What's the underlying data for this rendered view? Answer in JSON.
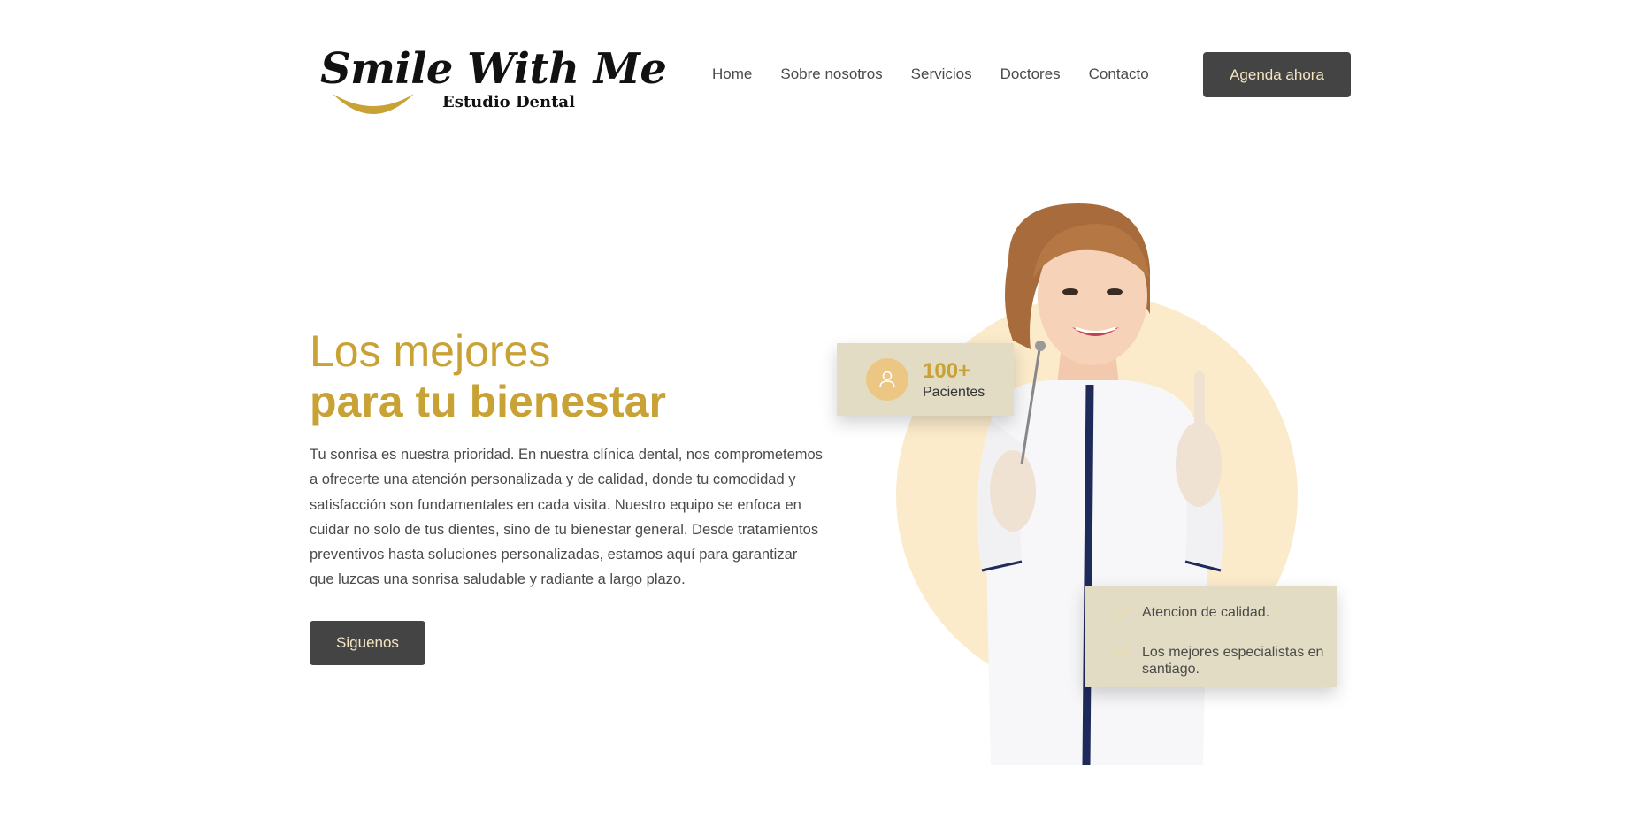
{
  "brand": {
    "title": "Smile With Me",
    "subtitle": "Estudio Dental",
    "accent": "#c9a235"
  },
  "nav": {
    "items": [
      {
        "label": "Home"
      },
      {
        "label": "Sobre nosotros"
      },
      {
        "label": "Servicios"
      },
      {
        "label": "Doctores"
      },
      {
        "label": "Contacto"
      }
    ],
    "cta_label": "Agenda ahora"
  },
  "hero": {
    "heading_line1": "Los mejores",
    "heading_line2": "para tu bienestar",
    "paragraph": "Tu sonrisa es nuestra prioridad. En nuestra clínica dental, nos comprometemos a ofrecerte una atención personalizada y de calidad, donde tu comodidad y satisfacción son fundamentales en cada visita. Nuestro equipo se enfoca en cuidar no solo de tus dientes, sino de tu bienestar general. Desde tratamientos preventivos hasta soluciones personalizadas, estamos aquí para garantizar que luzcas una sonrisa saludable y radiante a largo plazo.",
    "button_label": "Siguenos"
  },
  "stat_card": {
    "icon": "user-icon",
    "number": "100+",
    "label": "Pacientes"
  },
  "features_card": {
    "icon": "check-icon",
    "items": [
      {
        "label": "Atencion de calidad."
      },
      {
        "label": "Los mejores especialistas en santiago."
      }
    ]
  },
  "colors": {
    "button_bg": "#444444",
    "button_text": "#f4e6c4",
    "card_bg": "#e2dcc4",
    "circle_bg": "#fbebcb"
  }
}
